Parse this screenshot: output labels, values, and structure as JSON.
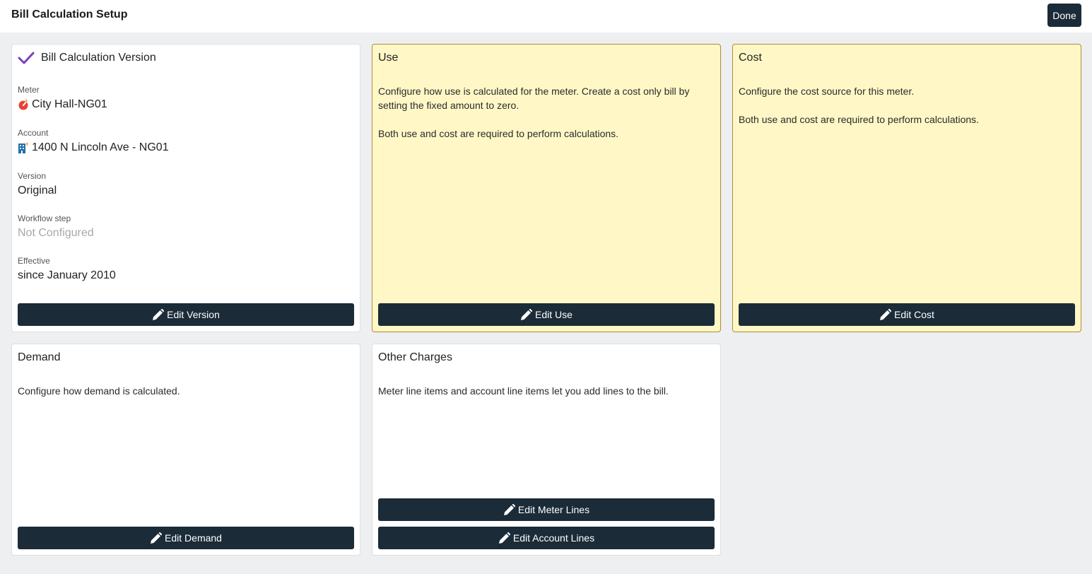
{
  "header": {
    "title": "Bill Calculation Setup",
    "done_label": "Done"
  },
  "colors": {
    "primary": "#1b2b38",
    "warning_bg": "#fff8c6",
    "warning_border": "#b08a3a",
    "check": "#7c3fbf"
  },
  "version_card": {
    "title": "Bill Calculation Version",
    "status_icon": "check-icon",
    "meter_label": "Meter",
    "meter_icon": "gas-meter-icon",
    "meter_value": "City Hall-NG01",
    "account_label": "Account",
    "account_icon": "building-icon",
    "account_value": "1400 N Lincoln Ave - NG01",
    "version_label": "Version",
    "version_value": "Original",
    "workflow_label": "Workflow step",
    "workflow_value": "Not Configured",
    "effective_label": "Effective",
    "effective_value": "since January 2010",
    "button_label": "Edit Version"
  },
  "use_card": {
    "title": "Use",
    "desc1": "Configure how use is calculated for the meter. Create a cost only bill by setting the fixed amount to zero.",
    "desc2": "Both use and cost are required to perform calculations.",
    "button_label": "Edit Use"
  },
  "cost_card": {
    "title": "Cost",
    "desc1": "Configure the cost source for this meter.",
    "desc2": "Both use and cost are required to perform calculations.",
    "button_label": "Edit Cost"
  },
  "demand_card": {
    "title": "Demand",
    "desc1": "Configure how demand is calculated.",
    "button_label": "Edit Demand"
  },
  "other_card": {
    "title": "Other Charges",
    "desc1": "Meter line items and account line items let you add lines to the bill.",
    "meter_lines_label": "Edit Meter Lines",
    "account_lines_label": "Edit Account Lines"
  }
}
